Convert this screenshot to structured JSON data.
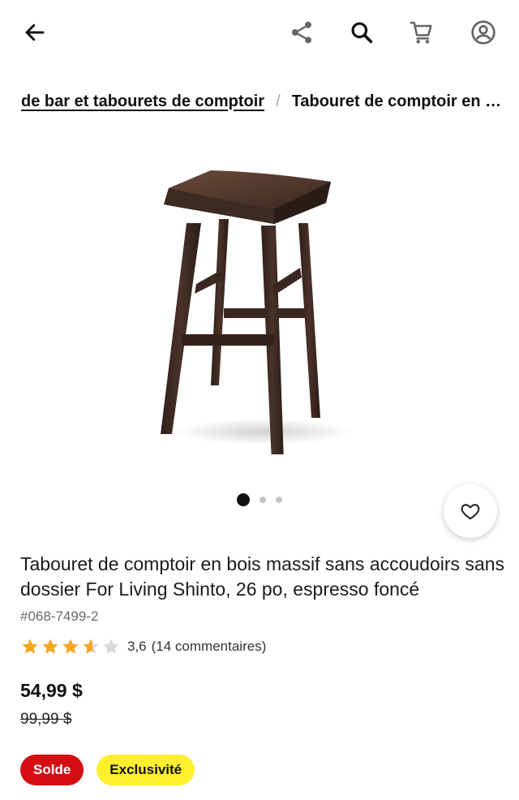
{
  "topbar": {
    "icons": [
      "back-arrow-icon",
      "share-icon",
      "search-icon",
      "cart-icon",
      "account-icon"
    ]
  },
  "breadcrumb": {
    "parent": "de bar et tabourets de comptoir",
    "separator": "/",
    "current": "Tabouret de comptoir en bois massif sans accoudoirs"
  },
  "gallery": {
    "image": "bar-stool-product-image",
    "slide_count": 3,
    "active_slide": 1
  },
  "product": {
    "title": "Tabouret de comptoir en bois massif sans accoudoirs sans dossier For Living Shinto, 26 po, espresso foncé",
    "sku": "#068-7499-2",
    "rating_value": 3.6,
    "rating_label": "3,6",
    "reviews_label": "(14 commentaires)",
    "price": "54,99 $",
    "old_price": "99,99 $"
  },
  "badges": {
    "sale": "Solde",
    "exclusive": "Exclusivité"
  },
  "colors": {
    "sale_badge": "#d40d12",
    "exclusive_badge": "#ffef2e",
    "star_filled": "#f5a623",
    "star_empty": "#d9d9d9"
  }
}
